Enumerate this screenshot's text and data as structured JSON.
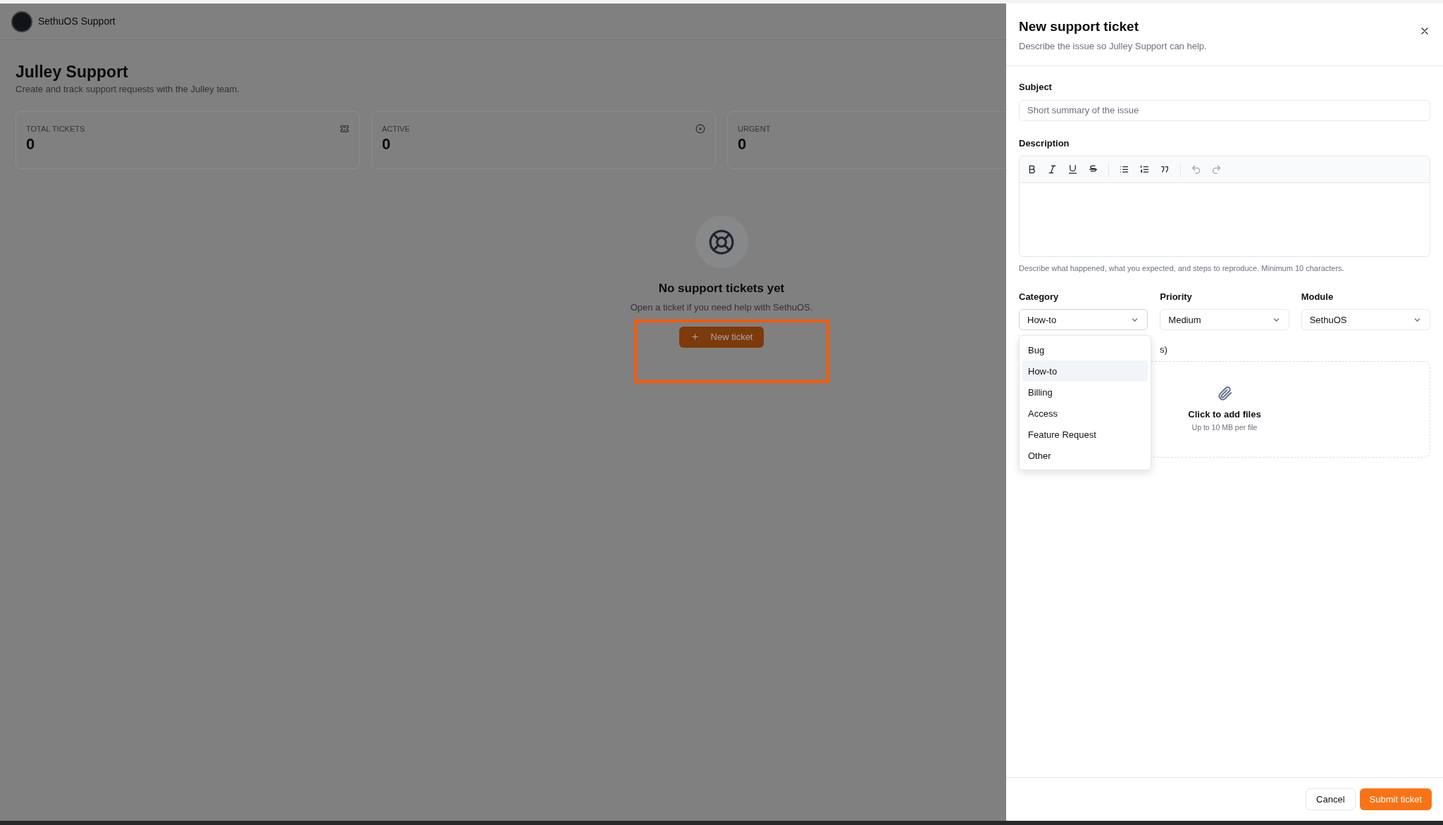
{
  "app": {
    "name": "SethuOS Support"
  },
  "page": {
    "title": "Julley Support",
    "subtitle": "Create and track support requests with the Julley team."
  },
  "stats": [
    {
      "label": "TOTAL TICKETS",
      "value": "0"
    },
    {
      "label": "ACTIVE",
      "value": "0"
    },
    {
      "label": "URGENT",
      "value": "0"
    }
  ],
  "empty_state": {
    "title": "No support tickets yet",
    "text": "Open a ticket if you need help with SethuOS.",
    "button": "New ticket",
    "highlighted": true
  },
  "drawer": {
    "title": "New support ticket",
    "subtitle": "Describe the issue so Julley Support can help.",
    "subject": {
      "label": "Subject",
      "placeholder": "Short summary of the issue"
    },
    "description": {
      "label": "Description",
      "hint": "Describe what happened, what you expected, and steps to reproduce. Minimum 10 characters."
    },
    "selects": [
      {
        "label": "Category",
        "value": "How-to",
        "open": true,
        "options": [
          {
            "label": "Bug",
            "selected": false
          },
          {
            "label": "How-to",
            "selected": true
          },
          {
            "label": "Billing",
            "selected": false
          },
          {
            "label": "Access",
            "selected": false
          },
          {
            "label": "Feature Request",
            "selected": false
          },
          {
            "label": "Other",
            "selected": false
          }
        ]
      },
      {
        "label": "Priority",
        "value": "Medium",
        "open": false
      },
      {
        "label": "Module",
        "value": "SethuOS",
        "open": false
      }
    ],
    "attachments": {
      "label": "s)",
      "text": "Click to add files",
      "hint": "Up to 10 MB per file"
    },
    "buttons": [
      {
        "label": "Cancel",
        "kind": "secondary"
      },
      {
        "label": "Submit ticket",
        "kind": "primary"
      }
    ]
  }
}
